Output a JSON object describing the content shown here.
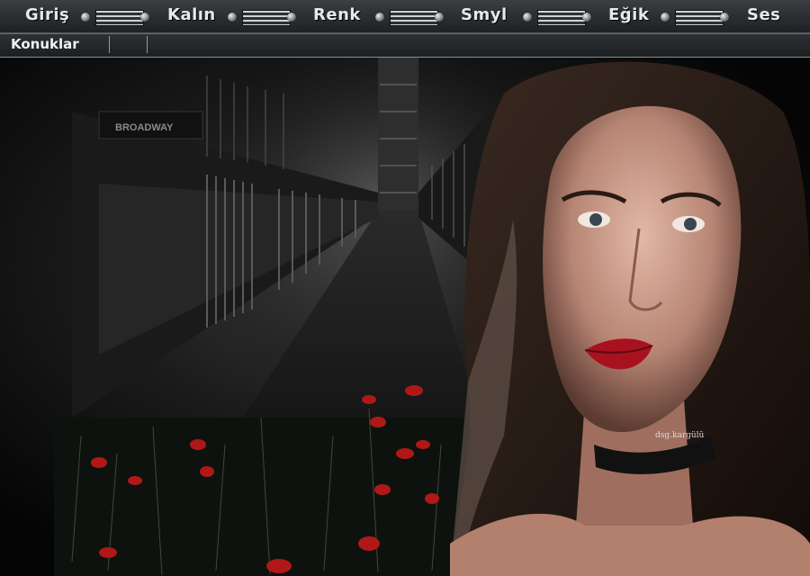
{
  "menu": {
    "items": [
      "Giriş",
      "Kalın",
      "Renk",
      "Smyl",
      "Eğik",
      "Ses"
    ]
  },
  "tabs": {
    "guests_label": "Konuklar"
  },
  "scene": {
    "sign_text": "BROADWAY",
    "watermark": "dsg.kargülü"
  },
  "colors": {
    "menubar": "#2b2f31",
    "accent_red": "#b01818"
  }
}
